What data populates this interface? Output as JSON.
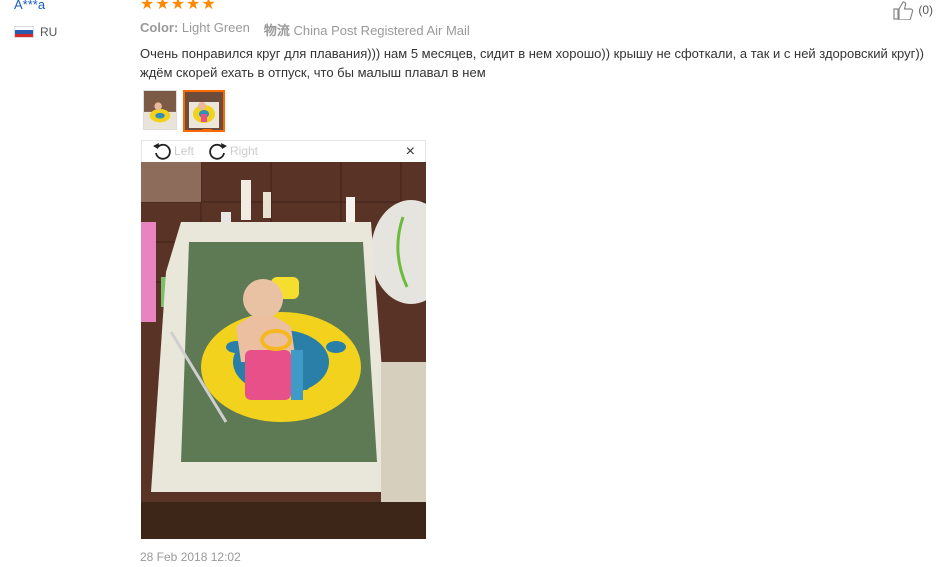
{
  "user": {
    "name": "A***a",
    "country": "RU"
  },
  "rating": {
    "stars": 5,
    "color": "#ff8a00"
  },
  "like": {
    "count": "(0)"
  },
  "meta": {
    "color_label": "Color:",
    "color_value": "Light Green",
    "shipping_label": "物流",
    "shipping_value": "China Post Registered Air Mail"
  },
  "review": {
    "text": "Очень понравился круг для плавания))) нам 5 месяцев, сидит в нем хорошо)) крышу не сфоткали, а так и с ней здоровский круг)) ждём скорей ехать в отпуск, что бы малыш плавал в нем"
  },
  "viewer": {
    "left_label": "Left",
    "right_label": "Right",
    "close_label": "×"
  },
  "date": "28 Feb 2018 12:02",
  "colors": {
    "accent": "#ff6a00",
    "link": "#1a5cbf",
    "muted": "#999999"
  }
}
